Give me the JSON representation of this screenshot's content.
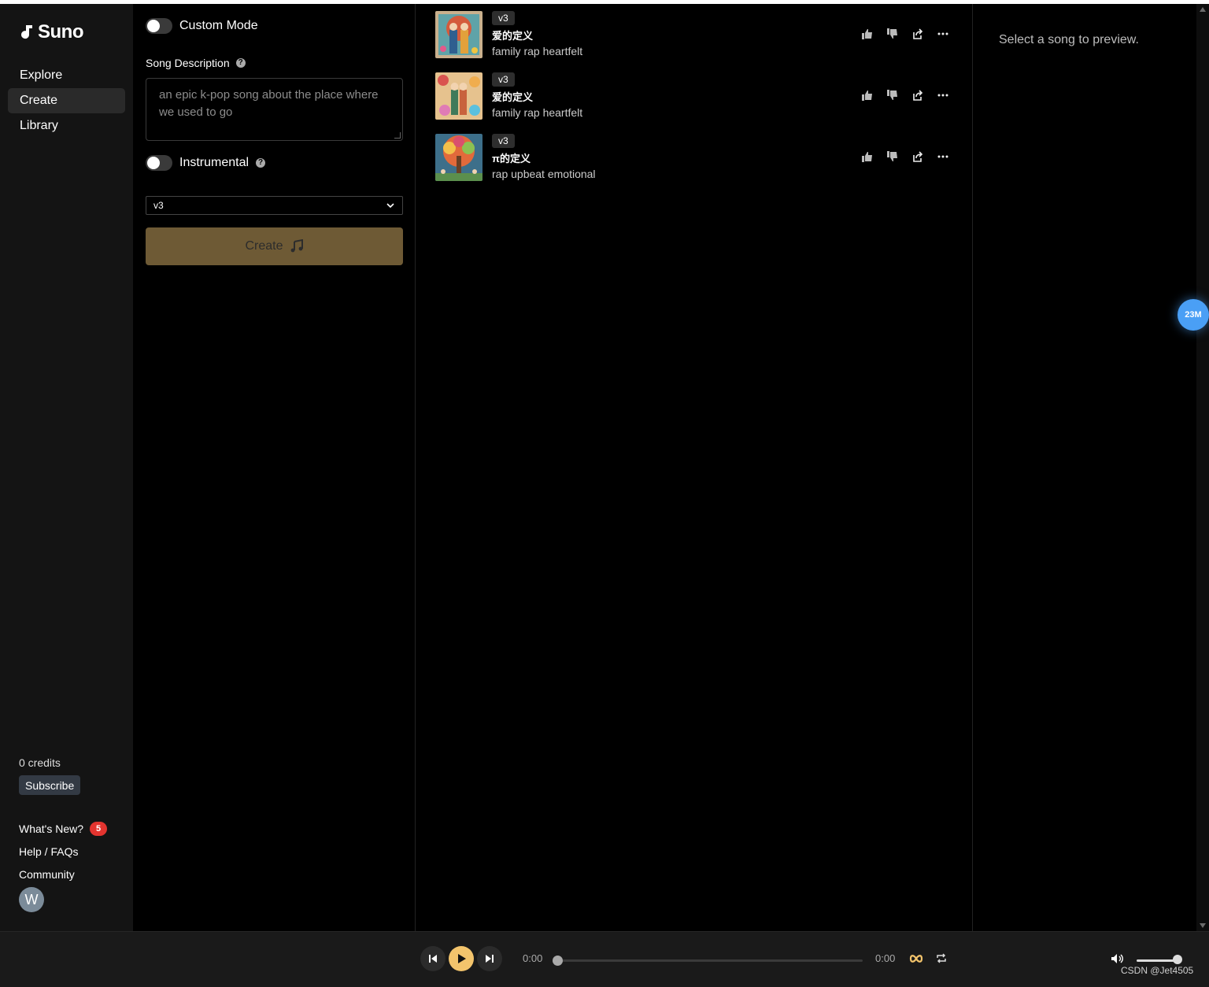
{
  "app": {
    "logo_text": "Suno",
    "accent_color": "#f3c46c",
    "create_button_color": "#6e5a35"
  },
  "sidebar": {
    "nav": [
      {
        "label": "Explore",
        "active": false
      },
      {
        "label": "Create",
        "active": true
      },
      {
        "label": "Library",
        "active": false
      }
    ],
    "credits": "0 credits",
    "subscribe_label": "Subscribe",
    "links": {
      "whats_new": "What's New?",
      "whats_new_badge": "5",
      "help": "Help / FAQs",
      "community": "Community"
    },
    "avatar_initial": "W"
  },
  "create_panel": {
    "custom_mode_label": "Custom Mode",
    "custom_mode_on": false,
    "song_description_label": "Song Description",
    "song_description_placeholder": "an epic k-pop song about the place where we used to go",
    "instrumental_label": "Instrumental",
    "instrumental_on": false,
    "model_select_value": "v3",
    "create_button_label": "Create"
  },
  "songs": [
    {
      "version": "v3",
      "title": "爱的定义",
      "tags": "family rap heartfelt",
      "cover_icon": "family-painting-cover"
    },
    {
      "version": "v3",
      "title": "爱的定义",
      "tags": "family rap heartfelt",
      "cover_icon": "family-flowers-cover"
    },
    {
      "version": "v3",
      "title": "π的定义",
      "tags": "rap upbeat emotional",
      "cover_icon": "tree-of-life-cover"
    }
  ],
  "preview": {
    "empty_text": "Select a song to preview."
  },
  "floating_badge": "23M",
  "player": {
    "current_time": "0:00",
    "total_time": "0:00",
    "progress": 0,
    "volume": 1.0
  },
  "watermark": "CSDN @Jet4505"
}
